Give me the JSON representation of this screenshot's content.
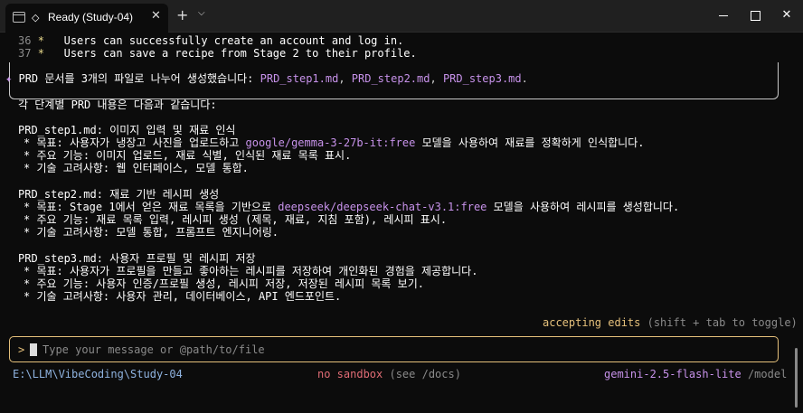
{
  "window": {
    "tab_title": "Ready (Study-04)",
    "tab_status_glyph": "◇",
    "new_tab_glyph": "+",
    "dropdown_glyph": "⌵",
    "close_glyph": "✕"
  },
  "scrollback": [
    {
      "num": "36",
      "bullet": "*",
      "text": "Users can successfully create an account and log in."
    },
    {
      "num": "37",
      "bullet": "*",
      "text": "Users can save a recipe from Stage 2 to their profile."
    }
  ],
  "response": {
    "sparkle": "✦",
    "intro_prefix": "PRD 문서를 3개의 파일로 나누어 생성했습니다: ",
    "files": [
      "PRD_step1.md",
      "PRD_step2.md",
      "PRD_step3.md"
    ],
    "summary": "각 단계별 PRD 내용은 다음과 같습니다:",
    "steps": [
      {
        "file": "PRD_step1.md",
        "title": "이미지 입력 및 재료 인식",
        "goal_label": "목표",
        "goal_before": "사용자가 냉장고 사진을 업로드하고 ",
        "goal_model": "google/gemma-3-27b-it:free",
        "goal_after": " 모델을 사용하여 재료를 정확하게 인식합니다.",
        "features": "주요 기능: 이미지 업로드, 재료 식별, 인식된 재료 목록 표시.",
        "tech_label": "기술 고려사항",
        "tech": "웹 인터페이스, 모델 통합."
      },
      {
        "file": "PRD_step2.md",
        "title": "재료 기반 레시피 생성",
        "goal_label": "목표",
        "goal_before": "Stage 1에서 얻은 재료 목록을 기반으로 ",
        "goal_model": "deepseek/deepseek-chat-v3.1:free",
        "goal_after": " 모델을 사용하여 레시피를 생성합니다.",
        "features": "주요 기능: 재료 목록 입력, 레시피 생성 (제목, 재료, 지침 포함), 레시피 표시.",
        "tech_label": "기술 고려사항",
        "tech": "모델 통합, 프롬프트 엔지니어링."
      },
      {
        "file": "PRD_step3.md",
        "title": "사용자 프로필 및 레시피 저장",
        "goal_label": "목표",
        "goal_before": "사용자가 프로필을 만들고 좋아하는 레시피를 저장하여 개인화된 경험을 제공합니다.",
        "goal_model": "",
        "goal_after": "",
        "features": "주요 기능: 사용자 인증/프로필 생성, 레시피 저장, 저장된 레시피 목록 보기.",
        "tech_label": "기술 고려사항",
        "tech": "사용자 관리, 데이터베이스, API 엔드포인트."
      }
    ]
  },
  "status": {
    "mode": "accepting edits",
    "hint": " (shift + tab to toggle)"
  },
  "input": {
    "prompt": ">",
    "placeholder": "Type your message or @path/to/file"
  },
  "footer": {
    "cwd": "E:\\LLM\\VibeCoding\\Study-04",
    "sandbox": "no sandbox",
    "sandbox_hint": " (see /docs)",
    "model": "gemini-2.5-flash-lite",
    "model_cmd": " /model"
  },
  "colors": {
    "background": "#0c0c0c",
    "accent_yellow": "#e5c07b",
    "accent_purple": "#c792ea",
    "error_red": "#e06c75",
    "path_blue": "#8fb3e0"
  }
}
